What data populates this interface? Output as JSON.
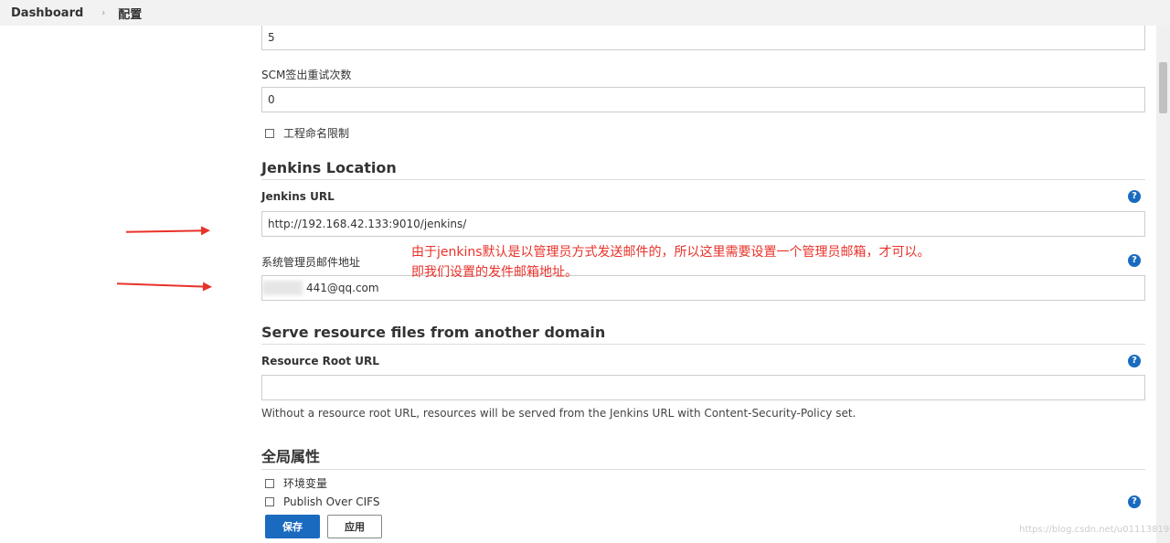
{
  "breadcrumb": {
    "home": "Dashboard",
    "current": "配置"
  },
  "fields": {
    "top_value": "5",
    "scm_retry": {
      "label": "SCM签出重试次数",
      "value": "0"
    },
    "project_naming": {
      "label": "工程命名限制"
    }
  },
  "jenkins_location": {
    "title": "Jenkins Location",
    "url_label": "Jenkins URL",
    "url_value": "http://192.168.42.133:9010/jenkins/",
    "email_label": "系统管理员邮件地址",
    "email_value": "441@qq.com"
  },
  "resource": {
    "title": "Serve resource files from another domain",
    "root_label": "Resource Root URL",
    "root_value": "",
    "description": "Without a resource root URL, resources will be served from the Jenkins URL with Content-Security-Policy set."
  },
  "global": {
    "title": "全局属性",
    "env_vars": "环境变量",
    "publish_cifs": "Publish Over CIFS"
  },
  "help_symbol": "?",
  "annotation": {
    "line1": "由于jenkins默认是以管理员方式发送邮件的，所以这里需要设置一个管理员邮箱，才可以。",
    "line2": "即我们设置的发件邮箱地址。"
  },
  "buttons": {
    "save": "保存",
    "apply": "应用"
  },
  "watermark": "https://blog.csdn.net/u011138190",
  "colors": {
    "accent": "#1a6bbf",
    "annotation": "#e8322a"
  }
}
